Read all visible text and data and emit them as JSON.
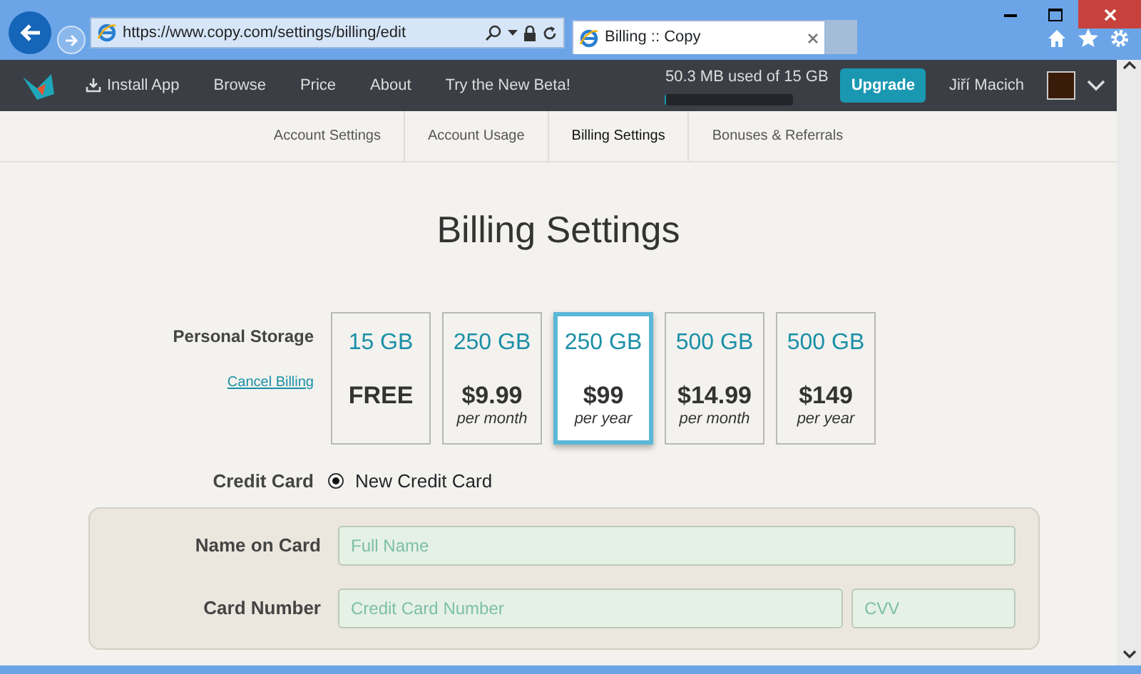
{
  "browser": {
    "address": "https://www.copy.com/settings/billing/edit",
    "tabs": [
      {
        "title": "Billing :: Copy",
        "selected": true
      }
    ]
  },
  "nav": {
    "items": [
      "Install App",
      "Browse",
      "Price",
      "About",
      "Try the New Beta!"
    ],
    "storage": {
      "text": "50.3 MB used of 15 GB",
      "level": 0.003
    },
    "upgrade": "Upgrade",
    "user": "Jiří Macich"
  },
  "subnav": [
    {
      "label": "Account Settings",
      "selected": false
    },
    {
      "label": "Account Usage",
      "selected": false
    },
    {
      "label": "Billing Settings",
      "selected": true
    },
    {
      "label": "Bonuses & Referrals",
      "selected": false
    }
  ],
  "title": "Billing Settings",
  "storage": {
    "label": "Personal Storage",
    "cancel": "Cancel Billing",
    "plans": [
      {
        "size": "15 GB",
        "price": "FREE",
        "selected": false
      },
      {
        "size": "250 GB",
        "price": "$9.99",
        "period": "per month",
        "selected": false
      },
      {
        "size": "250 GB",
        "price": "$99",
        "period": "per year",
        "selected": true
      },
      {
        "size": "500 GB",
        "price": "$14.99",
        "period": "per month",
        "selected": false
      },
      {
        "size": "500 GB",
        "price": "$149",
        "period": "per year",
        "selected": false
      }
    ]
  },
  "credit_card": {
    "label": "Credit Card",
    "options": [
      {
        "label": "New Credit Card",
        "selected": true
      }
    ]
  },
  "fields": [
    {
      "label": "Name on Card",
      "inputs": [
        {
          "placeholder": "Full Name"
        }
      ]
    },
    {
      "label": "Card Number",
      "inputs": [
        {
          "placeholder": "Credit Card Number"
        },
        {
          "placeholder": "CVV"
        }
      ]
    }
  ]
}
